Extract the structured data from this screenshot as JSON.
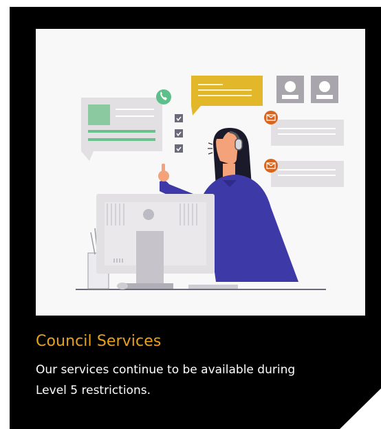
{
  "card": {
    "title": "Council Services",
    "description": "Our services continue to be available during Level 5 restrictions."
  },
  "colors": {
    "card_background": "#000000",
    "title_color": "#e8a318",
    "text_color": "#ffffff",
    "illustration_background": "#f8f8f8",
    "accent_purple": "#3d3aa8",
    "accent_yellow": "#e2b729",
    "accent_green": "#5dbf8a",
    "accent_orange": "#d9651c"
  },
  "illustration": {
    "icons": [
      "phone-icon",
      "mail-icon",
      "checkbox-icon",
      "headset-icon"
    ]
  }
}
